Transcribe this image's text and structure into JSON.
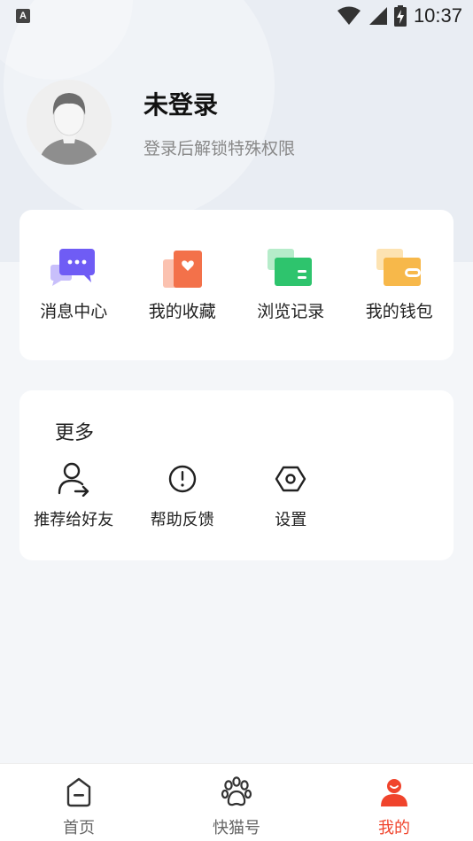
{
  "status_bar": {
    "left_icon": "A",
    "time": "10:37"
  },
  "profile": {
    "username": "未登录",
    "subtitle": "登录后解锁特殊权限"
  },
  "quick_actions": [
    {
      "label": "消息中心",
      "icon": "message-icon"
    },
    {
      "label": "我的收藏",
      "icon": "favorite-icon"
    },
    {
      "label": "浏览记录",
      "icon": "history-icon"
    },
    {
      "label": "我的钱包",
      "icon": "wallet-icon"
    }
  ],
  "more": {
    "title": "更多",
    "items": [
      {
        "label": "推荐给好友",
        "icon": "share-user-icon"
      },
      {
        "label": "帮助反馈",
        "icon": "help-icon"
      },
      {
        "label": "设置",
        "icon": "settings-icon"
      }
    ]
  },
  "bottom_nav": [
    {
      "label": "首页",
      "icon": "home-icon"
    },
    {
      "label": "快猫号",
      "icon": "paw-icon"
    },
    {
      "label": "我的",
      "icon": "profile-icon"
    }
  ],
  "colors": {
    "accent": "#f0442c",
    "message": "#6f5cf5",
    "favorite": "#f3714a",
    "history": "#2ec46d",
    "wallet": "#f7b84a"
  }
}
